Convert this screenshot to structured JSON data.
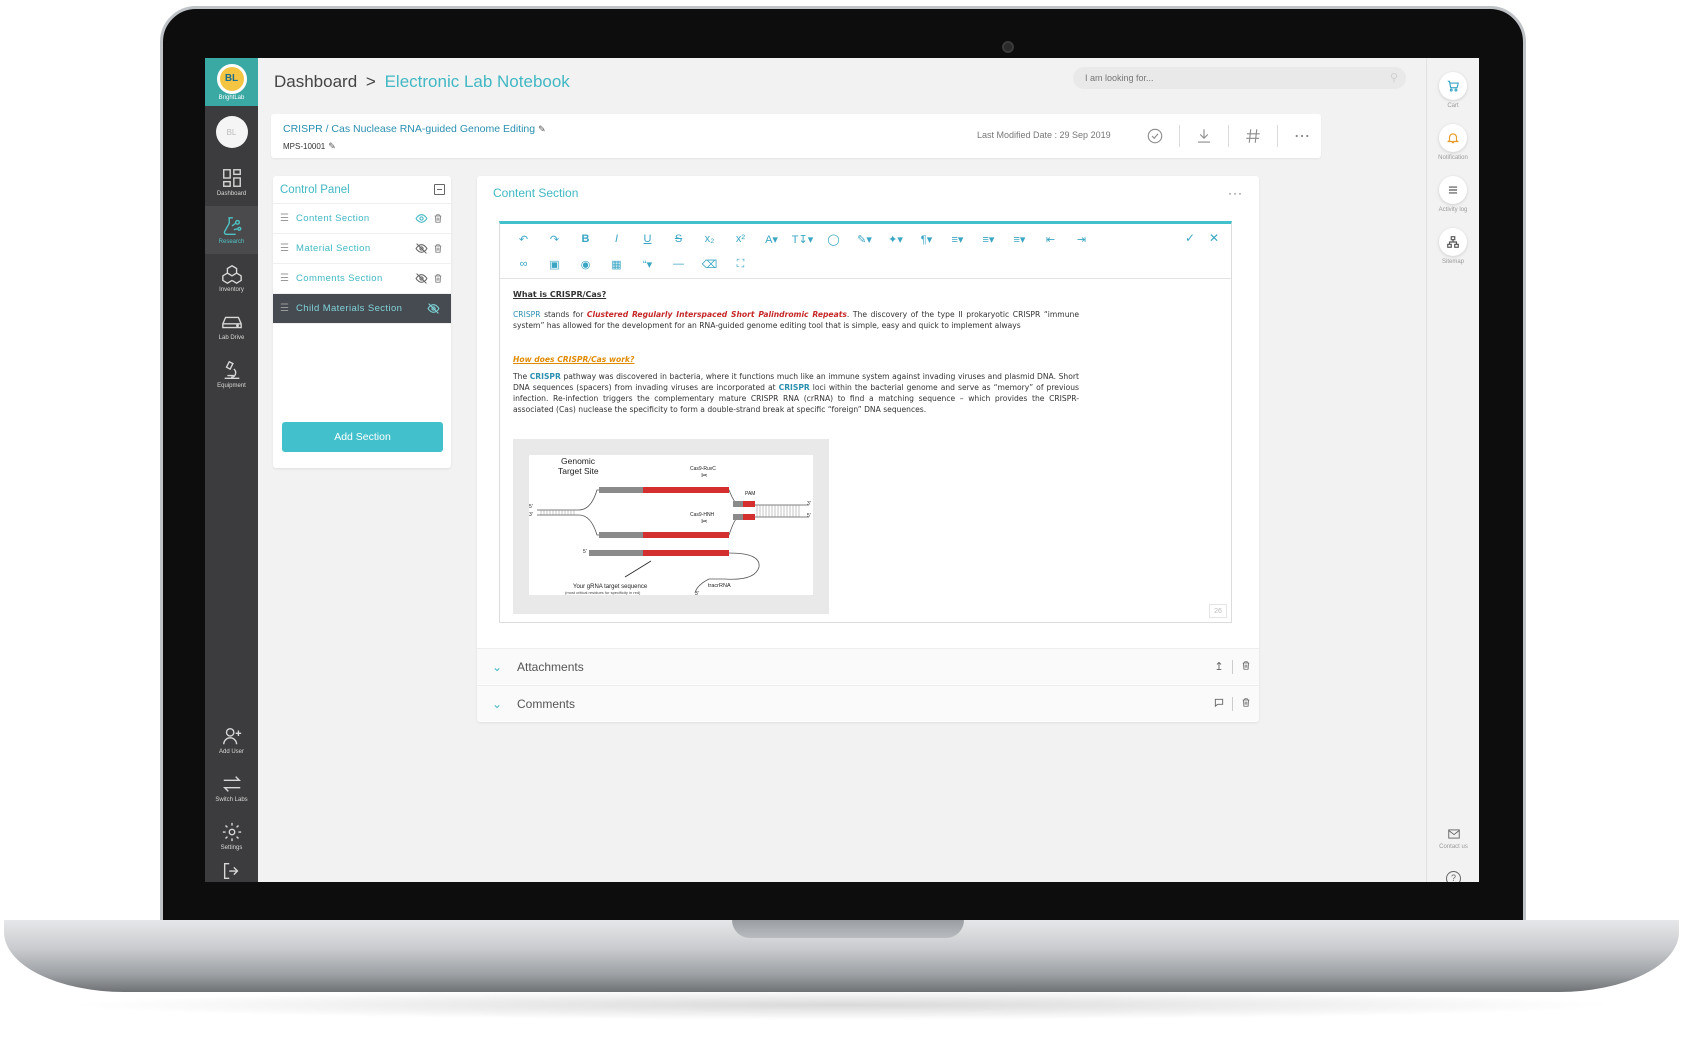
{
  "app": {
    "brand": "BL",
    "brand_name": "BrightLab"
  },
  "sidebar": {
    "avatar_initials": "BL",
    "items": [
      {
        "label": "Dashboard",
        "icon": "dashboard-icon"
      },
      {
        "label": "Research",
        "icon": "research-icon",
        "active": true
      },
      {
        "label": "Inventory",
        "icon": "inventory-icon"
      },
      {
        "label": "Lab Drive",
        "icon": "drive-icon"
      },
      {
        "label": "Equipment",
        "icon": "microscope-icon"
      }
    ],
    "bottom": [
      {
        "label": "Add User",
        "icon": "add-user-icon"
      },
      {
        "label": "Switch Labs",
        "icon": "switch-icon"
      },
      {
        "label": "Settings",
        "icon": "gear-icon"
      }
    ]
  },
  "rightrail": {
    "items": [
      {
        "label": "Cart",
        "icon": "cart-icon"
      },
      {
        "label": "Notification",
        "icon": "bell-icon"
      },
      {
        "label": "Activity log",
        "icon": "menu-icon"
      },
      {
        "label": "Sitemap",
        "icon": "sitemap-icon"
      }
    ],
    "contact": "Contact us"
  },
  "header": {
    "crumb_root": "Dashboard",
    "crumb_sep": ">",
    "crumb_current": "Electronic Lab Notebook",
    "search_placeholder": "I am looking for..."
  },
  "document": {
    "title": "CRISPR / Cas Nuclease RNA-guided Genome Editing",
    "id": "MPS-10001",
    "last_modified": "Last Modified Date : 29 Sep 2019"
  },
  "control_panel": {
    "title": "Control Panel",
    "items": [
      {
        "label": "Content Section",
        "visible": true
      },
      {
        "label": "Material Section",
        "visible": false
      },
      {
        "label": "Comments Section",
        "visible": false
      },
      {
        "label": "Child Materials Section",
        "visible": false,
        "active": true
      }
    ],
    "add_button": "Add Section"
  },
  "content_section": {
    "title": "Content Section",
    "body": {
      "heading1": "What is CRISPR/Cas?",
      "p1_kw": "CRISPR",
      "p1_a": " stands for ",
      "p1_em": "Clustered Regularly Interspaced Short Palindromic Repeats",
      "p1_b": ". The discovery of the type II prokaryotic CRISPR “immune system” has allowed for the development for an RNA-guided genome editing tool that is simple, easy and quick to implement always",
      "heading2": "How does CRISPR/Cas work?",
      "p2_a": "The ",
      "p2_kw1": "CRISPR",
      "p2_b": " pathway was discovered in bacteria, where it functions much like an immune system against invading viruses and plasmid DNA. Short DNA sequences (spacers) from invading viruses are incorporated at ",
      "p2_kw2": "CRISPR",
      "p2_c": " loci within the bacterial genome and serve as “memory” of previous infection. Re-infection triggers the complementary mature CRISPR RNA (crRNA) to find a matching sequence – which provides the CRISPR-associated (Cas) nuclease the specificity to form a double-strand break at specific “foreign” DNA sequences."
    },
    "figure": {
      "label_genomic": "Genomic",
      "label_target": "Target Site",
      "label_ruvc": "Cas9-RuvC",
      "label_hnh": "Cas9-HNH",
      "label_pam": "PAM",
      "label_grna": "Your gRNA target sequence",
      "label_grna_sub": "(most critical residues for specificity in red)",
      "label_tracr": "tracrRNA",
      "five": "5'",
      "three": "3'"
    },
    "page_number": "26"
  },
  "accordions": {
    "attachments": "Attachments",
    "comments": "Comments"
  },
  "colors": {
    "accent": "#42b8c4",
    "sidebar": "#3c3c3e",
    "brand": "#3aa9a3",
    "red": "#c62828",
    "orange": "#e08a00"
  }
}
